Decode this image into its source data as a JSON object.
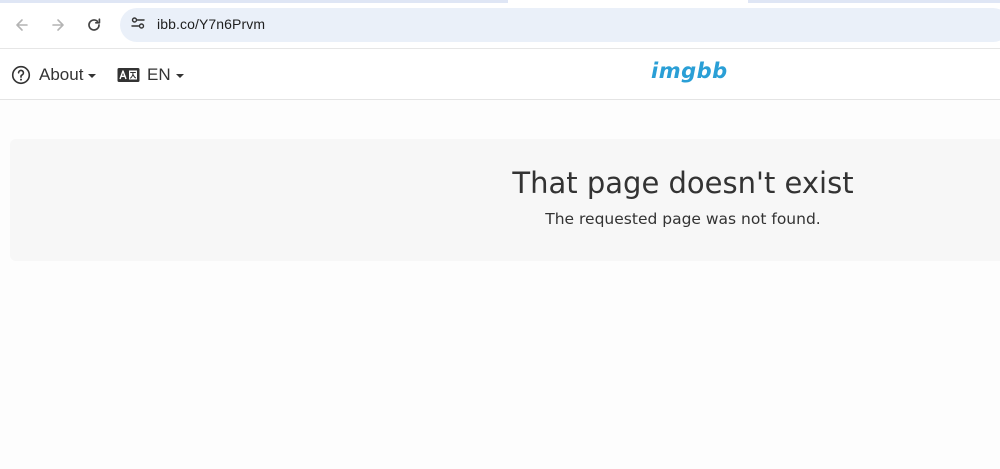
{
  "browser": {
    "url": "ibb.co/Y7n6Prvm",
    "back_icon": "arrow-left-icon",
    "forward_icon": "arrow-right-icon",
    "reload_icon": "reload-icon",
    "site_info_icon": "tune-icon"
  },
  "header": {
    "about_label": "About",
    "about_icon": "question-circle-icon",
    "language_label": "EN",
    "language_icon": "language-icon",
    "logo_text": "imgbb",
    "logo_color": "#2a9fd6"
  },
  "main": {
    "title": "That page doesn't exist",
    "subtitle": "The requested page was not found."
  }
}
